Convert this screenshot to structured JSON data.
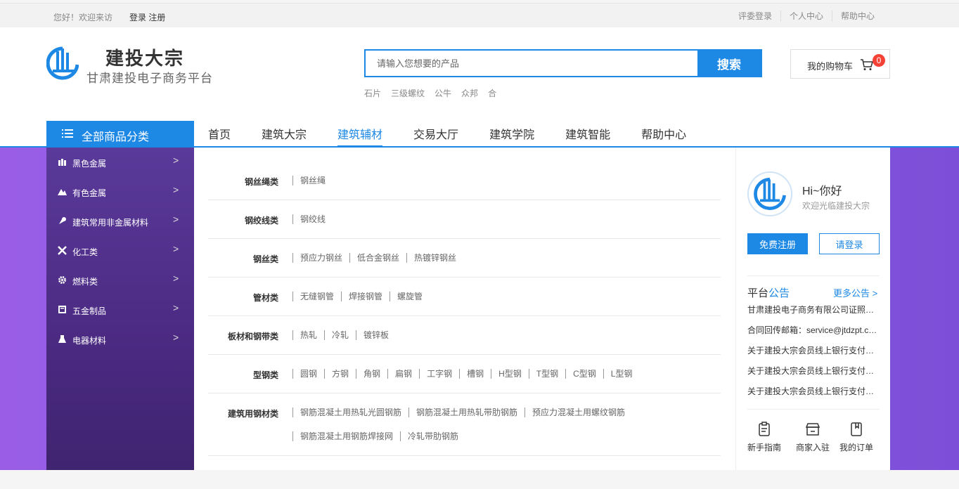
{
  "topbar": {
    "greeting": "您好！欢迎来访",
    "login_register": "登录 注册",
    "links": [
      "评委登录",
      "个人中心",
      "帮助中心"
    ]
  },
  "logo": {
    "title": "建投大宗",
    "subtitle": "甘肃建投电子商务平台"
  },
  "search": {
    "placeholder": "请输入您想要的产品",
    "button": "搜索",
    "hotwords": [
      "石片",
      "三级螺纹",
      "公牛",
      "众邦",
      "合"
    ]
  },
  "cart": {
    "label": "我的购物车",
    "count": "0"
  },
  "nav": {
    "all_categories": "全部商品分类",
    "links": [
      "首页",
      "建筑大宗",
      "建筑辅材",
      "交易大厅",
      "建筑学院",
      "建筑智能",
      "帮助中心"
    ],
    "active_index": 2
  },
  "sidebar": {
    "items": [
      {
        "label": "黑色金属",
        "icon": "metal-icon"
      },
      {
        "label": "有色金属",
        "icon": "mountain-icon"
      },
      {
        "label": "建筑常用非金属材料",
        "icon": "paint-icon"
      },
      {
        "label": "化工类",
        "icon": "tools-icon"
      },
      {
        "label": "燃料类",
        "icon": "gear-icon"
      },
      {
        "label": "五金制品",
        "icon": "book-icon"
      },
      {
        "label": "电器材料",
        "icon": "flask-icon"
      }
    ]
  },
  "categories": [
    {
      "name": "钢丝绳类",
      "items": [
        "钢丝绳"
      ]
    },
    {
      "name": "钢绞线类",
      "items": [
        "钢绞线"
      ]
    },
    {
      "name": "钢丝类",
      "items": [
        "预应力钢丝",
        "低合金钢丝",
        "热镀锌钢丝"
      ]
    },
    {
      "name": "管材类",
      "items": [
        "无缝钢管",
        "焊接钢管",
        "螺旋管"
      ]
    },
    {
      "name": "板材和钢带类",
      "items": [
        "热轧",
        "冷轧",
        "镀锌板"
      ]
    },
    {
      "name": "型钢类",
      "items": [
        "圆钢",
        "方钢",
        "角钢",
        "扁钢",
        "工字钢",
        "槽钢",
        "H型钢",
        "T型钢",
        "C型钢",
        "L型钢"
      ]
    },
    {
      "name": "建筑用钢材类",
      "items": [
        "钢筋混凝土用热轧光圆钢筋",
        "钢筋混凝土用热轧带肋钢筋",
        "预应力混凝土用螺纹钢筋",
        "钢筋混凝土用钢筋焊接网",
        "冷轧带肋钢筋"
      ]
    }
  ],
  "user_box": {
    "hi": "Hi~你好",
    "welcome": "欢迎光临建投大宗",
    "register": "免费注册",
    "login": "请登录"
  },
  "notices": {
    "title_prefix": "平台",
    "title_highlight": "公告",
    "more": "更多公告",
    "items": [
      "甘肃建投电子商务有限公司证照信息",
      "合同回传邮箱：service@jtdzpt.com",
      "关于建投大宗会员线上银行支付的通知",
      "关于建投大宗会员线上银行支付的通知",
      "关于建投大宗会员线上银行支付的通知"
    ]
  },
  "quick_links": [
    {
      "label": "新手指南",
      "icon": "guide-icon"
    },
    {
      "label": "商家入驻",
      "icon": "shop-icon"
    },
    {
      "label": "我的订单",
      "icon": "order-icon"
    }
  ],
  "colors": {
    "accent": "#1e88e5",
    "banner_purple": "#8a55e0",
    "sidebar_purple": "#4b2a82",
    "badge_red": "#f44336"
  }
}
